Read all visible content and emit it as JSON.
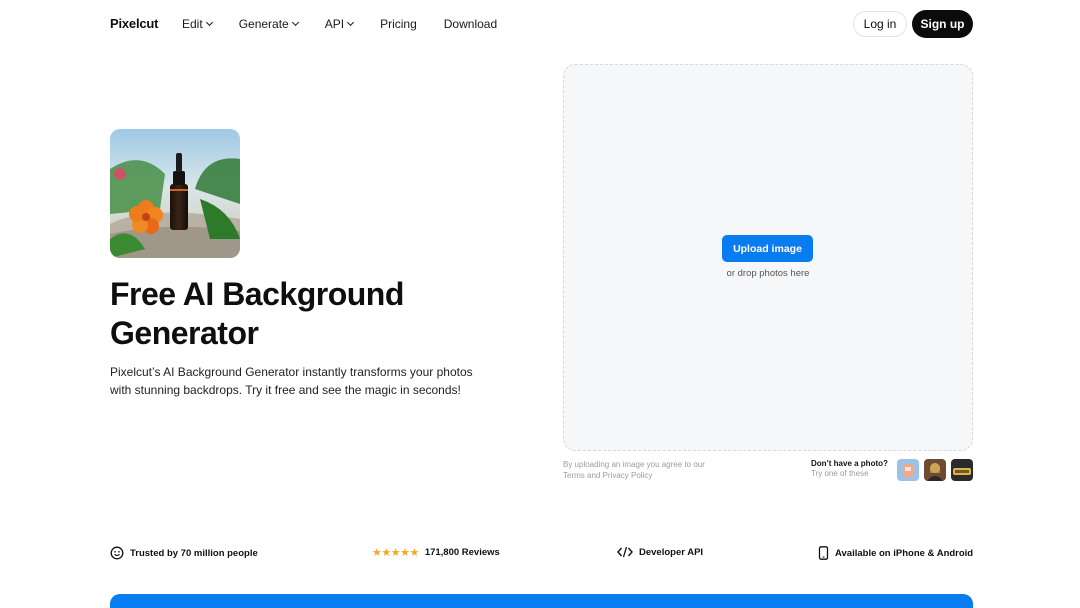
{
  "nav": {
    "logo": "Pixelcut",
    "items": [
      {
        "label": "Edit",
        "dropdown": true
      },
      {
        "label": "Generate",
        "dropdown": true
      },
      {
        "label": "API",
        "dropdown": true
      },
      {
        "label": "Pricing",
        "dropdown": false
      },
      {
        "label": "Download",
        "dropdown": false
      }
    ],
    "login": "Log in",
    "signup": "Sign up"
  },
  "hero": {
    "title": "Free AI Background Generator",
    "subtitle": "Pixelcut’s AI Background Generator instantly transforms your photos with stunning backdrops. Try it free and see the magic in seconds!",
    "image_alt": "product bottle on rocks with tropical flower"
  },
  "upload": {
    "button": "Upload image",
    "drop_text": "or drop photos here",
    "terms": "By uploading an image you agree to our Terms and Privacy Policy",
    "try_title": "Don’t have a photo?",
    "try_sub": "Try one of these"
  },
  "features": {
    "trusted": "Trusted by 70 million people",
    "stars": "★★★★★",
    "reviews": "171,800 Reviews",
    "api": "Developer API",
    "mobile": "Available on iPhone & Android"
  },
  "colors": {
    "accent": "#0a7cf2",
    "dark": "#0b0b0c",
    "star": "#f5a623",
    "upload_bg": "#f6f7f9"
  }
}
